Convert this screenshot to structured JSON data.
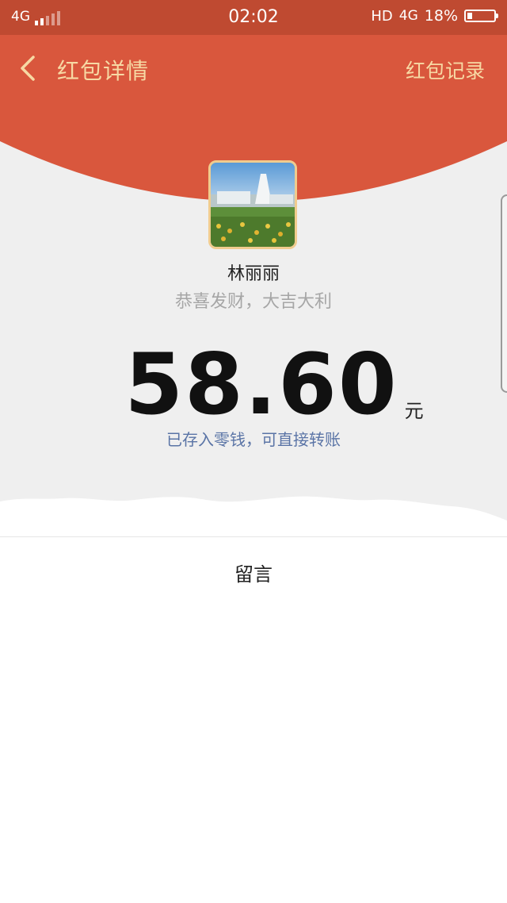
{
  "status_bar": {
    "network_left": "4G",
    "signal_level": 2,
    "signal_max": 5,
    "time": "02:02",
    "hd": "HD",
    "network_right": "4G",
    "battery_percent_text": "18%",
    "battery_level": 0.18
  },
  "nav": {
    "back_icon": "chevron-left-icon",
    "title": "红包详情",
    "action_label": "红包记录"
  },
  "packet": {
    "sender_name": "林丽丽",
    "greeting": "恭喜发财，大吉大利",
    "amount": "58.60",
    "currency": "元",
    "deposit_note": "已存入零钱，可直接转账"
  },
  "message_section": {
    "label": "留言"
  },
  "colors": {
    "header_red": "#d9573d",
    "title_gold": "#f7d9a4",
    "link_blue": "#5a74a6",
    "background_gray": "#efefef"
  }
}
